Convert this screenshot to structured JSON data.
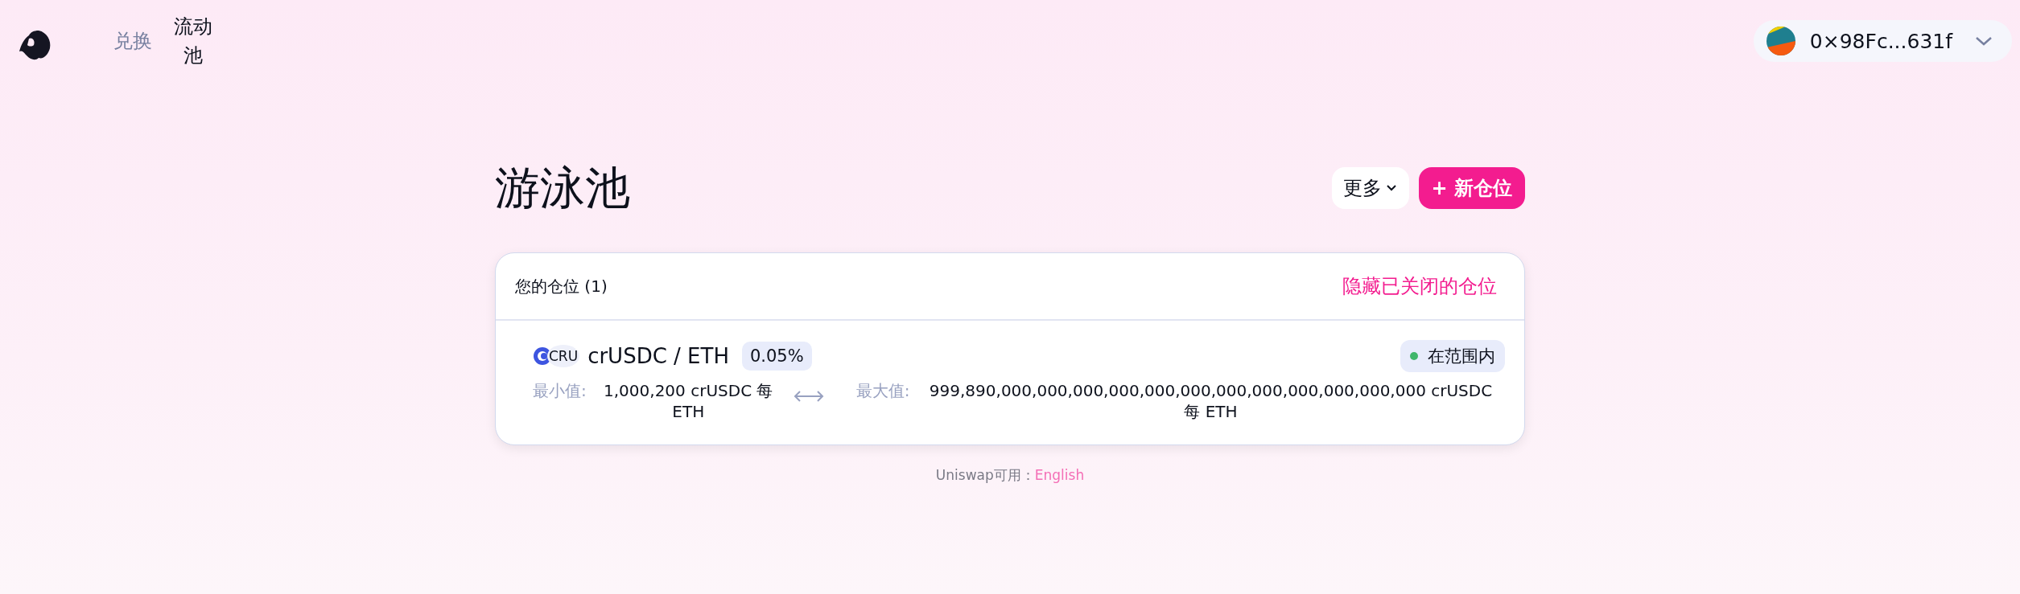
{
  "nav": {
    "items": [
      {
        "label": "兑换",
        "selected": false
      },
      {
        "label": "流动池",
        "selected": true
      }
    ]
  },
  "wallet": {
    "address": "0×98Fc...631f"
  },
  "page": {
    "title": "游泳池",
    "more_button": "更多",
    "new_position_button": "+ 新仓位"
  },
  "positions": {
    "header": "您的仓位 (1)",
    "hide_closed_link": "隐藏已关闭的仓位",
    "items": [
      {
        "token_symbol": "CRU",
        "pair": "crUSDC / ETH",
        "fee": "0.05%",
        "in_range": true,
        "status": "在范围内",
        "min_label": "最小值:",
        "min_value": "1,000,200 crUSDC 每 ETH",
        "max_label": "最大值:",
        "max_value": "999,890,000,000,000,000,000,000,000,000,000,000,000,000 crUSDC 每 ETH"
      }
    ]
  },
  "footer": {
    "text": "Uniswap可用：",
    "language_link": "English"
  }
}
